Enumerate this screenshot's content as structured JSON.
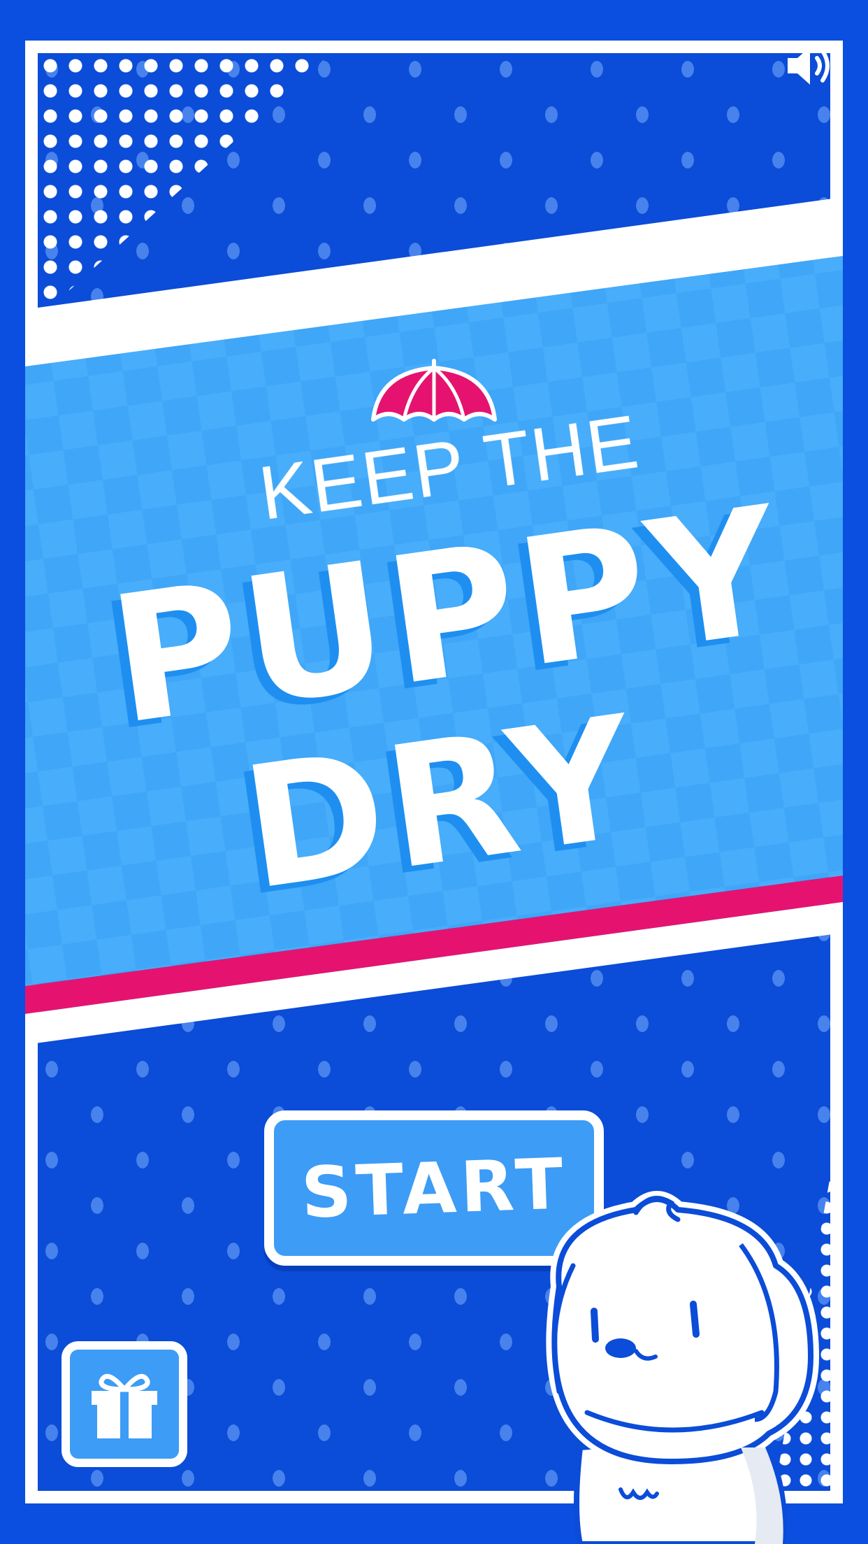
{
  "title": {
    "line1": "KEEP THE",
    "line2": "PUPPY",
    "line3": "DRY"
  },
  "buttons": {
    "start_label": "START"
  },
  "icons": {
    "sound": "speaker-on-icon",
    "gift": "gift-icon",
    "umbrella": "umbrella-icon",
    "mascot": "puppy-mascot"
  },
  "colors": {
    "background_blue": "#0b4cd8",
    "banner_blue": "#3fa6f8",
    "accent_pink": "#e5136f",
    "button_blue": "#3d9cf5",
    "title_shadow": "#1e8ff0",
    "white": "#ffffff"
  }
}
